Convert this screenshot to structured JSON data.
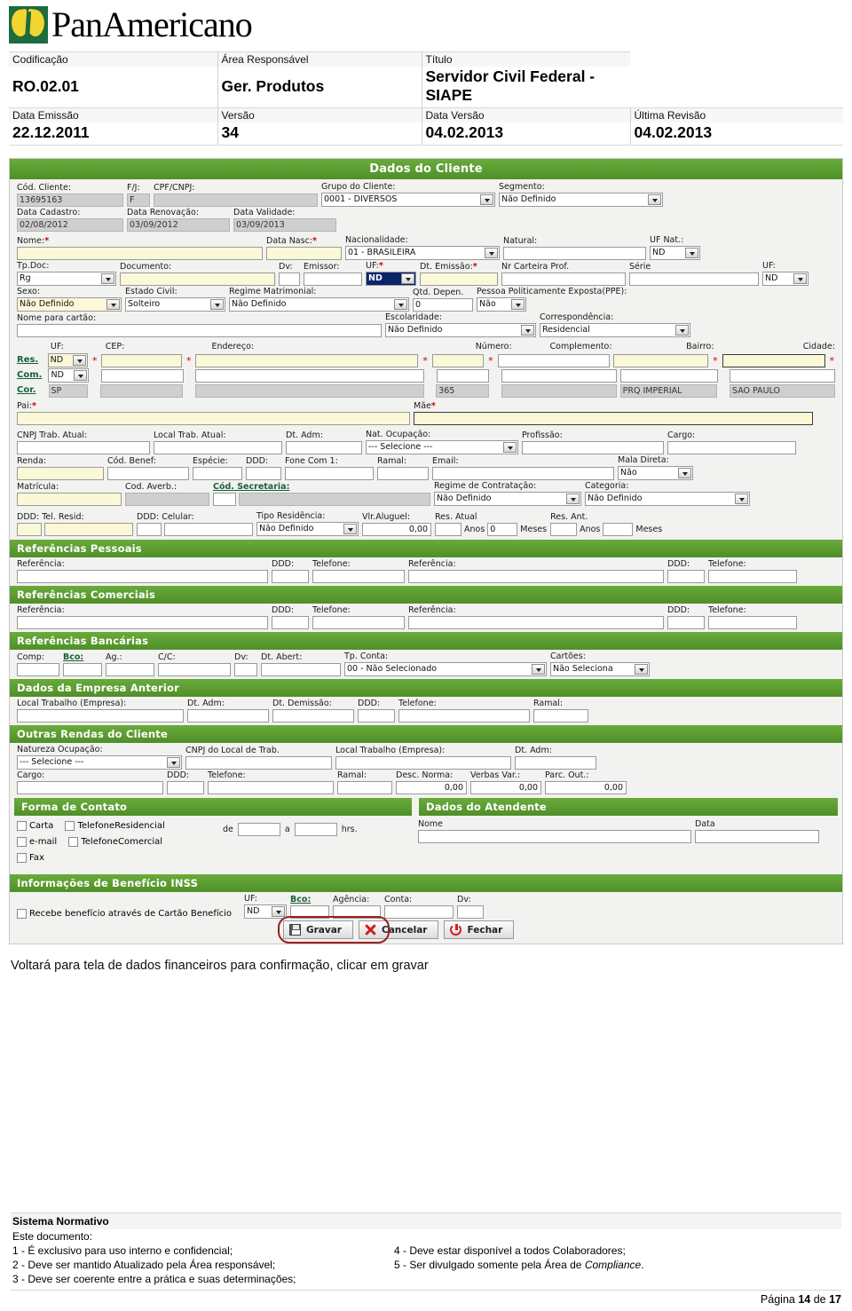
{
  "brand": {
    "logo_text": "PanAmericano"
  },
  "doc_meta": {
    "labels": [
      "Codificação",
      "Área Responsável",
      "Título"
    ],
    "values": [
      "RO.02.01",
      "Ger. Produtos",
      "Servidor Civil Federal - SIAPE"
    ],
    "labels2": [
      "Data Emissão",
      "Versão",
      "Data Versão",
      "Última Revisão"
    ],
    "values2": [
      "22.12.2011",
      "34",
      "04.02.2013",
      "04.02.2013"
    ]
  },
  "screen": {
    "sections": {
      "cliente": "Dados do Cliente",
      "ref_pessoais": "Referências Pessoais",
      "ref_comerciais": "Referências Comerciais",
      "ref_bancarias": "Referências Bancárias",
      "empresa_anterior": "Dados da Empresa Anterior",
      "outras_rendas": "Outras Rendas do Cliente",
      "forma_contato": "Forma de Contato",
      "dados_atendente": "Dados do Atendente",
      "beneficio_inss": "Informações de Benefício INSS"
    },
    "cliente": {
      "cod_cliente_label": "Cód. Cliente:",
      "cod_cliente_value": "13695163",
      "fj_label": "F/J:",
      "fj_value": "F",
      "cpf_cnpj_label": "CPF/CNPJ:",
      "cpf_cnpj_value": "",
      "grupo_label": "Grupo do Cliente:",
      "grupo_value": "0001 - DIVERSOS",
      "segmento_label": "Segmento:",
      "segmento_value": "Não Definido",
      "data_cadastro_label": "Data Cadastro:",
      "data_cadastro_value": "02/08/2012",
      "data_renovacao_label": "Data Renovação:",
      "data_renovacao_value": "03/09/2012",
      "data_validade_label": "Data Validade:",
      "data_validade_value": "03/09/2013",
      "nome_label": "Nome:",
      "nome_value": "",
      "data_nasc_label": "Data Nasc:",
      "data_nasc_value": "",
      "nacionalidade_label": "Nacionalidade:",
      "nacionalidade_value": "01 - BRASILEIRA",
      "natural_label": "Natural:",
      "natural_value": "",
      "uf_nat_label": "UF Nat.:",
      "uf_nat_value": "ND",
      "tp_doc_label": "Tp.Doc:",
      "tp_doc_value": "Rg",
      "documento_label": "Documento:",
      "documento_value": "",
      "dv_label": "Dv:",
      "dv_value": "",
      "emissor_label": "Emissor:",
      "emissor_value": "",
      "uf_doc_label": "UF:",
      "uf_doc_value": "ND",
      "dt_emissao_label": "Dt. Emissão:",
      "dt_emissao_value": "",
      "nr_carteira_label": "Nr Carteira Prof.",
      "nr_carteira_value": "",
      "serie_label": "Série",
      "serie_value": "",
      "uf_serie_label": "UF:",
      "uf_serie_value": "ND",
      "sexo_label": "Sexo:",
      "sexo_value": "Não Definido",
      "estado_civil_label": "Estado Civil:",
      "estado_civil_value": "Solteiro",
      "regime_matrimonial_label": "Regime Matrimonial:",
      "regime_matrimonial_value": "Não Definido",
      "qtd_depen_label": "Qtd. Depen.",
      "qtd_depen_value": "0",
      "ppe_label": "Pessoa Politicamente Exposta(PPE):",
      "ppe_value": "Não",
      "nome_cartao_label": "Nome para cartão:",
      "nome_cartao_value": "",
      "escolaridade_label": "Escolaridade:",
      "escolaridade_value": "Não Definido",
      "correspondencia_label": "Correspondência:",
      "correspondencia_value": "Residencial",
      "addr_headers": [
        "UF:",
        "CEP:",
        "Endereço:",
        "Número:",
        "Complemento:",
        "Bairro:",
        "Cidade:"
      ],
      "addr_rows": [
        {
          "tag": "Res.",
          "uf": "ND",
          "cep": "",
          "endereco": "",
          "numero": "",
          "complemento": "",
          "bairro": "",
          "cidade": ""
        },
        {
          "tag": "Com.",
          "uf": "ND",
          "cep": "",
          "endereco": "",
          "numero": "",
          "complemento": "",
          "bairro": "",
          "cidade": ""
        },
        {
          "tag": "Cor.",
          "uf": "SP",
          "cep": "",
          "endereco": "",
          "numero": "365",
          "complemento": "",
          "bairro": "PRQ IMPERIAL",
          "cidade": "SAO PAULO"
        }
      ],
      "pai_label": "Pai:",
      "pai_value": "",
      "mae_label": "Mãe",
      "mae_value": "",
      "cnpj_trab_label": "CNPJ Trab. Atual:",
      "cnpj_trab_value": "",
      "local_trab_label": "Local Trab. Atual:",
      "local_trab_value": "",
      "dt_adm_label": "Dt. Adm:",
      "dt_adm_value": "",
      "nat_ocupacao_label": "Nat. Ocupação:",
      "nat_ocupacao_value": "--- Selecione ---",
      "profissao_label": "Profissão:",
      "profissao_value": "",
      "cargo_label": "Cargo:",
      "cargo_value": "",
      "renda_label": "Renda:",
      "renda_value": "",
      "cod_benef_label": "Cód. Benef:",
      "cod_benef_value": "",
      "especie_label": "Espécie:",
      "especie_value": "",
      "ddd_com_label": "DDD:",
      "ddd_com_value": "",
      "fone_com_label": "Fone Com 1:",
      "fone_com_value": "",
      "ramal_label": "Ramal:",
      "ramal_value": "",
      "email_label": "Email:",
      "email_value": "",
      "mala_direta_label": "Mala Direta:",
      "mala_direta_value": "Não",
      "matricula_label": "Matrícula:",
      "matricula_value": "",
      "cod_averb_label": "Cod. Averb.:",
      "cod_averb_value": "",
      "cod_secretaria_label": "Cód. Secretaria:",
      "cod_secretaria_value": "",
      "cod_secretaria_desc": "",
      "regime_contratacao_label": "Regime de Contratação:",
      "regime_contratacao_value": "Não Definido",
      "categoria_label": "Categoria:",
      "categoria_value": "Não Definido",
      "ddd_resid_label": "DDD:",
      "ddd_resid_value": "",
      "tel_resid_label": "Tel. Resid:",
      "tel_resid_value": "",
      "ddd_cel_label": "DDD:",
      "ddd_cel_value": "",
      "celular_label": "Celular:",
      "celular_value": "",
      "tipo_residencia_label": "Tipo Residência:",
      "tipo_residencia_value": "Não Definido",
      "vlr_aluguel_label": "Vlr.Aluguel:",
      "vlr_aluguel_value": "0,00",
      "res_atual_label": "Res. Atual",
      "res_atual_anos": "",
      "res_atual_anos_unit": "Anos",
      "res_atual_meses": "0",
      "res_atual_meses_unit": "Meses",
      "res_ant_label": "Res. Ant.",
      "res_ant_anos": "",
      "res_ant_anos_unit": "Anos",
      "res_ant_meses": "",
      "res_ant_meses_unit": "Meses"
    },
    "referencias": {
      "referencia_label": "Referência:",
      "ddd_label": "DDD:",
      "telefone_label": "Telefone:",
      "pessoais": [
        {
          "nome": "",
          "ddd": "",
          "tel": ""
        },
        {
          "nome": "",
          "ddd": "",
          "tel": ""
        }
      ],
      "comerciais": [
        {
          "nome": "",
          "ddd": "",
          "tel": ""
        },
        {
          "nome": "",
          "ddd": "",
          "tel": ""
        }
      ]
    },
    "bancarias": {
      "comp_label": "Comp:",
      "comp_value": "",
      "bco_label": "Bco:",
      "bco_value": "",
      "ag_label": "Ag.:",
      "ag_value": "",
      "cc_label": "C/C:",
      "cc_value": "",
      "dv_label": "Dv:",
      "dv_value": "",
      "dt_abert_label": "Dt. Abert:",
      "dt_abert_value": "",
      "tp_conta_label": "Tp. Conta:",
      "tp_conta_value": "00 - Não Selecionado",
      "cartoes_label": "Cartões:",
      "cartoes_value": "Não Seleciona"
    },
    "empresa_anterior": {
      "local_label": "Local Trabalho (Empresa):",
      "local_value": "",
      "dt_adm_label": "Dt. Adm:",
      "dt_adm_value": "",
      "dt_demissao_label": "Dt. Demissão:",
      "dt_demissao_value": "",
      "ddd_label": "DDD:",
      "ddd_value": "",
      "telefone_label": "Telefone:",
      "telefone_value": "",
      "ramal_label": "Ramal:",
      "ramal_value": ""
    },
    "outras_rendas": {
      "natureza_label": "Natureza Ocupação:",
      "natureza_value": "--- Selecione ---",
      "cnpj_label": "CNPJ do Local de Trab.",
      "cnpj_value": "",
      "local_label": "Local Trabalho (Empresa):",
      "local_value": "",
      "dt_adm_label": "Dt. Adm:",
      "dt_adm_value": "",
      "cargo_label": "Cargo:",
      "cargo_value": "",
      "ddd_label": "DDD:",
      "ddd_value": "",
      "telefone_label": "Telefone:",
      "telefone_value": "",
      "ramal_label": "Ramal:",
      "ramal_value": "",
      "desc_norma_label": "Desc. Norma:",
      "desc_norma_value": "0,00",
      "verbas_var_label": "Verbas Var.:",
      "verbas_var_value": "0,00",
      "parc_out_label": "Parc. Out.:",
      "parc_out_value": "0,00"
    },
    "forma_contato": {
      "options": [
        "Carta",
        "TelefoneResidencial",
        "e-mail",
        "TelefoneComercial",
        "Fax"
      ],
      "de_label": "de",
      "de_value": "",
      "a_label": "a",
      "a_value": "",
      "hrs_label": "hrs."
    },
    "atendente": {
      "nome_label": "Nome",
      "nome_value": "",
      "data_label": "Data",
      "data_value": ""
    },
    "inss": {
      "checkbox_label": "Recebe benefício através de Cartão Benefício",
      "uf_label": "UF:",
      "uf_value": "ND",
      "bco_label": "Bco:",
      "bco_value": "",
      "agencia_label": "Agência:",
      "agencia_value": "",
      "conta_label": "Conta:",
      "conta_value": "",
      "dv_label": "Dv:",
      "dv_value": ""
    },
    "buttons": {
      "gravar": "Gravar",
      "cancelar": "Cancelar",
      "fechar": "Fechar"
    }
  },
  "caption": "Voltará para tela de dados financeiros para confirmação, clicar em gravar",
  "footer": {
    "title": "Sistema Normativo",
    "intro": "Este documento:",
    "col_left": [
      "1 - É exclusivo para uso interno e confidencial;",
      "2 - Deve ser mantido Atualizado pela Área responsável;",
      "3 - Deve ser coerente entre a prática e suas determinações;"
    ],
    "col_right_1": "4 - Deve estar disponível a todos Colaboradores;",
    "col_right_2_pre": "5 - Ser divulgado somente pela Área de ",
    "col_right_2_em": "Compliance",
    "col_right_2_post": ".",
    "page_pre": "Página ",
    "page_num": "14",
    "page_mid": " de ",
    "page_total": "17"
  },
  "colors": {
    "brand_green": "#1d6b3f",
    "brand_yellow": "#f2d530",
    "section_green": "#5a9e2f",
    "required_red": "#cc0000",
    "highlight_red": "#9b2020"
  }
}
